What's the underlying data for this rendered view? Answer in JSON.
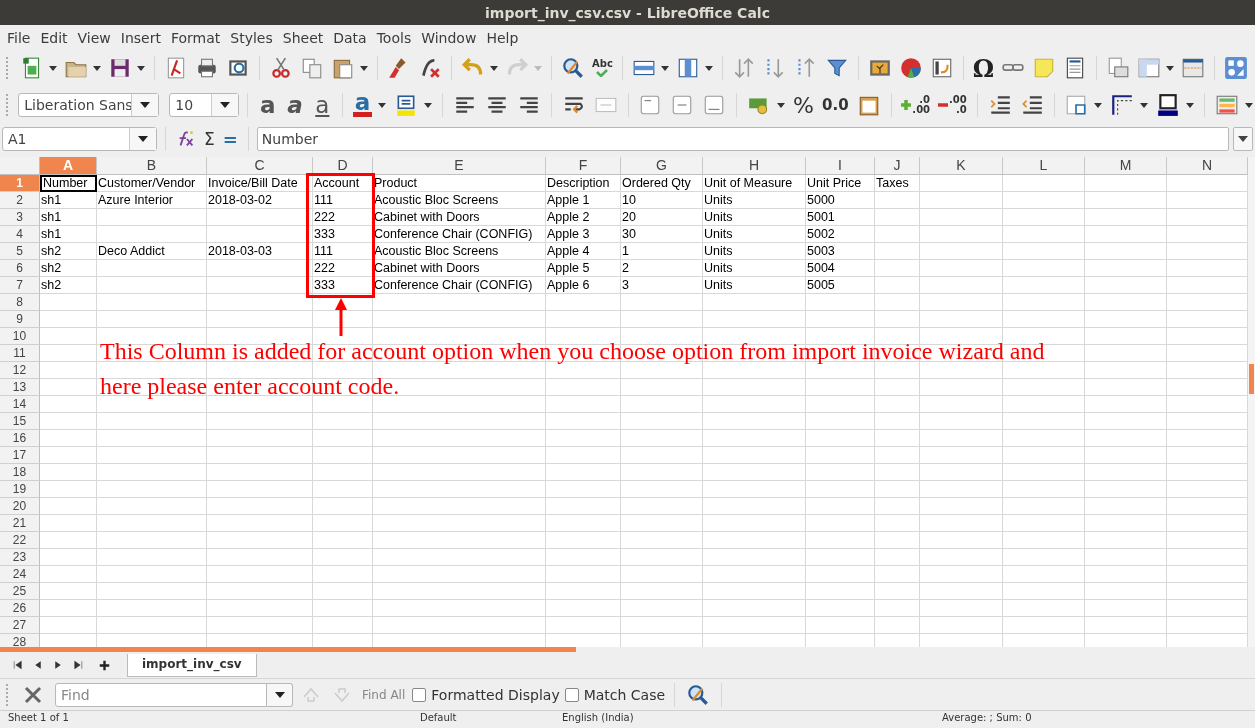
{
  "window": {
    "title": "import_inv_csv.csv - LibreOffice Calc"
  },
  "menu": [
    "File",
    "Edit",
    "View",
    "Insert",
    "Format",
    "Styles",
    "Sheet",
    "Data",
    "Tools",
    "Window",
    "Help"
  ],
  "standard_toolbar": {
    "spellcheck_label": "Abc",
    "special_character": "Ω",
    "redo": {
      "disabled": true
    }
  },
  "formatting_toolbar": {
    "font_name": "Liberation Sans",
    "font_size": "10",
    "bold": "a",
    "italic": "a",
    "underline": "a",
    "font_color": "a",
    "percent": "%",
    "number_format": "0.0",
    "add_decimal": [
      ".0",
      ".00"
    ],
    "delete_decimal": [
      ".00",
      ".0"
    ],
    "merge_cells": {
      "disabled": true
    }
  },
  "formula_bar": {
    "name_box": "A1",
    "sum": "Σ",
    "equals": "=",
    "content": "Number"
  },
  "grid": {
    "columns": [
      {
        "label": "A",
        "selected": true,
        "boxed": false
      },
      {
        "label": "B",
        "selected": false,
        "boxed": false
      },
      {
        "label": "C",
        "selected": false,
        "boxed": false
      },
      {
        "label": "D",
        "selected": false,
        "boxed": true
      },
      {
        "label": "E",
        "selected": false,
        "boxed": false
      },
      {
        "label": "F",
        "selected": false,
        "boxed": false
      },
      {
        "label": "G",
        "selected": false,
        "boxed": false
      },
      {
        "label": "H",
        "selected": false,
        "boxed": false
      },
      {
        "label": "I",
        "selected": false,
        "boxed": false
      },
      {
        "label": "J",
        "selected": false,
        "boxed": false
      },
      {
        "label": "K",
        "selected": false,
        "boxed": false
      },
      {
        "label": "L",
        "selected": false,
        "boxed": false
      },
      {
        "label": "M",
        "selected": false,
        "boxed": false
      },
      {
        "label": "N",
        "selected": false,
        "boxed": false
      }
    ],
    "rows": [
      {
        "number": "1",
        "selected": true,
        "boxed": true,
        "cells": {
          "A": "Number",
          "B": "Customer/Vendor",
          "C": "Invoice/Bill Date",
          "D": "Account",
          "E": "Product",
          "F": "Description",
          "G": "Ordered Qty",
          "H": "Unit of Measure",
          "I": "Unit Price",
          "J": "Taxes"
        }
      },
      {
        "number": "2",
        "selected": false,
        "boxed": true,
        "cells": {
          "A": "sh1",
          "B": "Azure Interior",
          "C": "2018-03-02",
          "D": "111",
          "E": "Acoustic Bloc Screens",
          "F": "Apple 1",
          "G": "10",
          "H": "Units",
          "I": "5000"
        }
      },
      {
        "number": "3",
        "selected": false,
        "boxed": true,
        "cells": {
          "A": "sh1",
          "D": "222",
          "E": "Cabinet with Doors",
          "F": "Apple 2",
          "G": "20",
          "H": "Units",
          "I": "5001"
        }
      },
      {
        "number": "4",
        "selected": false,
        "boxed": true,
        "cells": {
          "A": "sh1",
          "D": "333",
          "E": "Conference Chair (CONFIG)",
          "F": "Apple 3",
          "G": "30",
          "H": "Units",
          "I": "5002"
        }
      },
      {
        "number": "5",
        "selected": false,
        "boxed": true,
        "cells": {
          "A": "sh2",
          "B": "Deco Addict",
          "C": "2018-03-03",
          "D": "111",
          "E": "Acoustic Bloc Screens",
          "F": "Apple 4",
          "G": "1",
          "H": "Units",
          "I": "5003"
        }
      },
      {
        "number": "6",
        "selected": false,
        "boxed": true,
        "cells": {
          "A": "sh2",
          "D": "222",
          "E": "Cabinet with Doors",
          "F": "Apple 5",
          "G": "2",
          "H": "Units",
          "I": "5004"
        }
      },
      {
        "number": "7",
        "selected": false,
        "boxed": true,
        "cells": {
          "A": "sh2",
          "D": "333",
          "E": "Conference Chair (CONFIG)",
          "F": "Apple 6",
          "G": "3",
          "H": "Units",
          "I": "5005"
        }
      },
      {
        "number": "8",
        "selected": false,
        "cells": {}
      },
      {
        "number": "9",
        "selected": false,
        "cells": {}
      },
      {
        "number": "10",
        "selected": false,
        "cells": {}
      },
      {
        "number": "11",
        "selected": false,
        "cells": {}
      },
      {
        "number": "12",
        "selected": false,
        "cells": {}
      },
      {
        "number": "13",
        "selected": false,
        "cells": {}
      },
      {
        "number": "14",
        "selected": false,
        "cells": {}
      },
      {
        "number": "15",
        "selected": false,
        "cells": {}
      },
      {
        "number": "16",
        "selected": false,
        "cells": {}
      },
      {
        "number": "17",
        "selected": false,
        "cells": {}
      },
      {
        "number": "18",
        "selected": false,
        "cells": {}
      },
      {
        "number": "19",
        "selected": false,
        "cells": {}
      },
      {
        "number": "20",
        "selected": false,
        "cells": {}
      },
      {
        "number": "21",
        "selected": false,
        "cells": {}
      },
      {
        "number": "22",
        "selected": false,
        "cells": {}
      },
      {
        "number": "23",
        "selected": false,
        "cells": {}
      },
      {
        "number": "24",
        "selected": false,
        "cells": {}
      },
      {
        "number": "25",
        "selected": false,
        "cells": {}
      },
      {
        "number": "26",
        "selected": false,
        "cells": {}
      },
      {
        "number": "27",
        "selected": false,
        "cells": {}
      },
      {
        "number": "28",
        "selected": false,
        "cells": {}
      }
    ]
  },
  "annotation": {
    "text": "This Column is added for account option when you choose option from import invoice wizard and here please enter account code."
  },
  "sheet_tabs": [
    {
      "label": "import_inv_csv",
      "selected": true
    }
  ],
  "find_bar": {
    "placeholder": "Find",
    "previous": {
      "disabled": true
    },
    "next": {
      "disabled": true
    },
    "find_all": "Find All",
    "options": [
      {
        "label": "Formatted Display",
        "checked": false
      },
      {
        "label": "Match Case",
        "checked": false
      }
    ]
  },
  "status_bar": [
    "Sheet 1 of 1",
    "Default",
    "English (India)",
    "Average: ; Sum: 0"
  ]
}
